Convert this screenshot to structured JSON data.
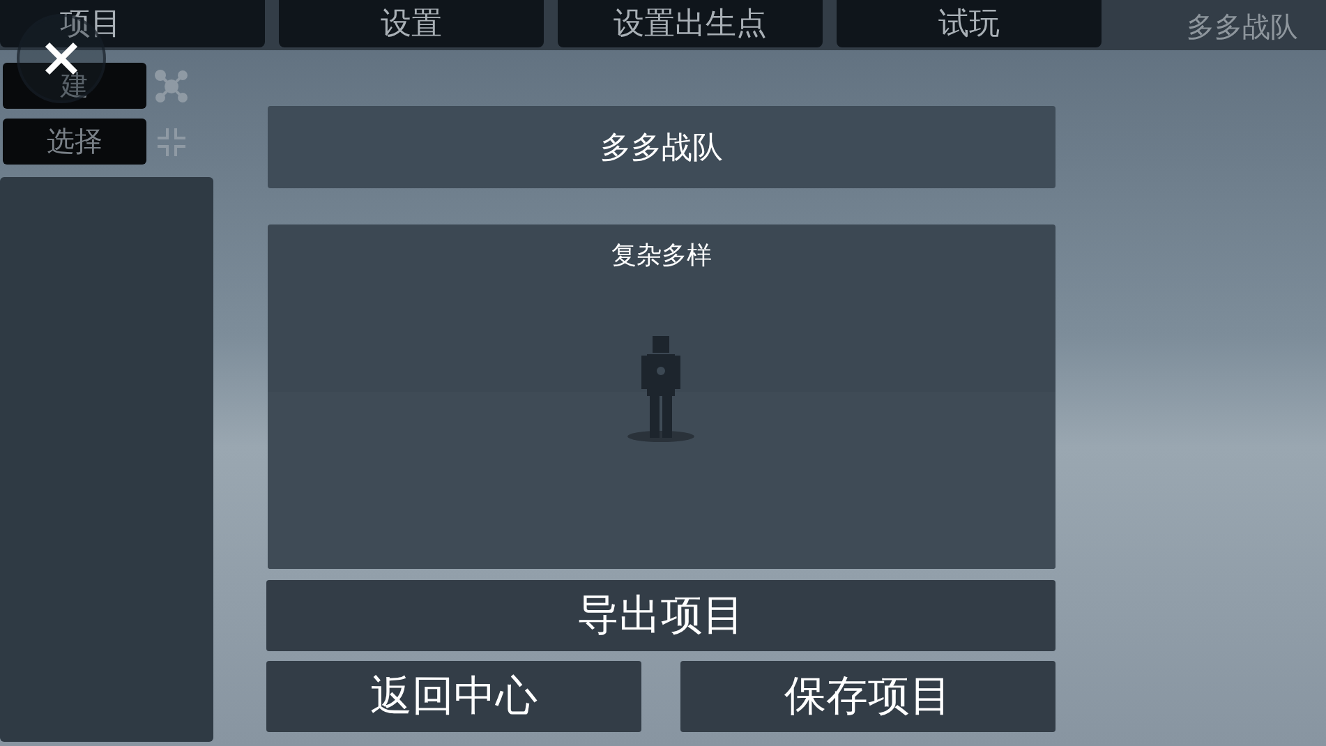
{
  "tabs": [
    {
      "label": "项目"
    },
    {
      "label": "设置"
    },
    {
      "label": "设置出生点"
    },
    {
      "label": "试玩"
    }
  ],
  "project_title": "多多战队",
  "tools": [
    {
      "label": "建",
      "kind": "nodes"
    },
    {
      "label": "选择",
      "kind": "select"
    }
  ],
  "name_field": {
    "value": "多多战队"
  },
  "preview": {
    "caption": "复杂多样",
    "kind": "picture"
  },
  "buttons": {
    "export": "导出项目",
    "back": "返回中心",
    "save": "保存项目"
  }
}
